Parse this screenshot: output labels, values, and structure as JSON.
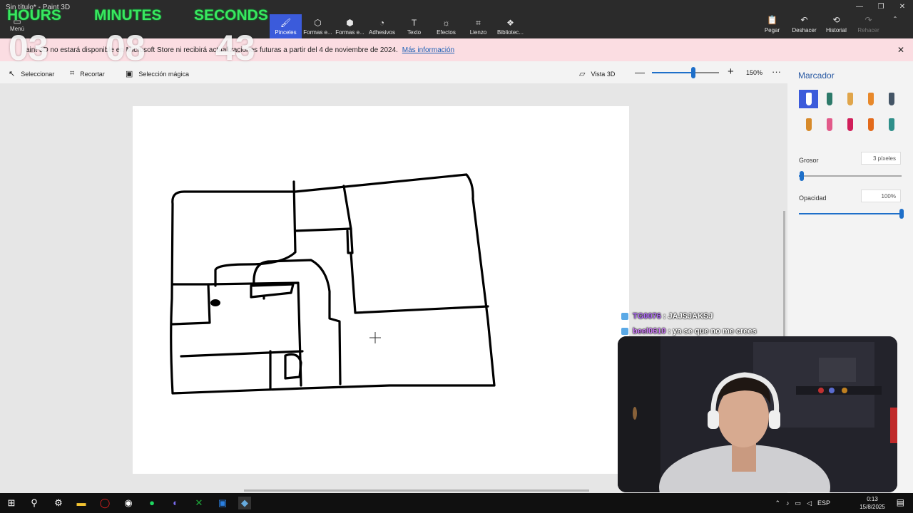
{
  "window": {
    "title": "Sin título* - Paint 3D",
    "controls": [
      "—",
      "❐",
      "✕"
    ]
  },
  "menu": {
    "label": "Menú",
    "icon": "folder-icon"
  },
  "ribbon": {
    "tools": [
      {
        "label": "Pinceles",
        "icon": "brush-icon",
        "glyph": "🖌"
      },
      {
        "label": "Formas e...",
        "icon": "2d-shapes-icon",
        "glyph": "⬡"
      },
      {
        "label": "Formas e...",
        "icon": "3d-shapes-icon",
        "glyph": "⬢"
      },
      {
        "label": "Adhesivos",
        "icon": "sticker-icon",
        "glyph": "◔"
      },
      {
        "label": "Texto",
        "icon": "text-icon",
        "glyph": "T"
      },
      {
        "label": "Efectos",
        "icon": "effects-icon",
        "glyph": "☼"
      },
      {
        "label": "Lienzo",
        "icon": "canvas-icon",
        "glyph": "⌗"
      },
      {
        "label": "Bibliotec...",
        "icon": "library-icon",
        "glyph": "❖"
      }
    ],
    "actions": [
      {
        "label": "Pegar",
        "glyph": "📋"
      },
      {
        "label": "Deshacer",
        "glyph": "↶"
      },
      {
        "label": "Historial",
        "glyph": "⟲"
      },
      {
        "label": "Rehacer",
        "glyph": "↷"
      }
    ],
    "collapse_glyph": "⌃"
  },
  "timer": {
    "labels": [
      "HOURS",
      "MINUTES",
      "SECONDS"
    ],
    "hours": "03",
    "minutes": "08",
    "seconds": "43"
  },
  "banner": {
    "text": "aint 3D no estará disponible en Microsoft Store ni recibirá actualizaciones futuras a partir del 4 de noviembre de 2024.",
    "link": "Más información",
    "close": "✕"
  },
  "subbar": {
    "select": "Seleccionar",
    "crop": "Recortar",
    "magic": "Selección mágica",
    "view3d": "Vista 3D",
    "zoom_percent": 0.62,
    "zoom_value": "150%",
    "more": "···",
    "minus": "—",
    "plus": "+"
  },
  "panel": {
    "title": "Marcador",
    "brushes": [
      {
        "name": "marker",
        "color": "#2a5aa3"
      },
      {
        "name": "calligraphy-pen",
        "color": "#2d7a6a"
      },
      {
        "name": "oil-brush",
        "color": "#e0a54a"
      },
      {
        "name": "watercolor",
        "color": "#e8882a"
      },
      {
        "name": "pixel-pen",
        "color": "#445566"
      },
      {
        "name": "pencil",
        "color": "#d78a2a"
      },
      {
        "name": "eraser",
        "color": "#e25a8a"
      },
      {
        "name": "crayon",
        "color": "#d11f5a"
      },
      {
        "name": "spray-can",
        "color": "#e36a1a"
      },
      {
        "name": "fill",
        "color": "#2f8f8a"
      }
    ],
    "thickness_label": "Grosor",
    "thickness_value": "3 píxeles",
    "thickness_level": 0.03,
    "opacity_label": "Opacidad",
    "opacity_value": "100%",
    "opacity_level": 1.0
  },
  "chat": [
    {
      "user": "TG0076",
      "message": "JAJSJAKSJ",
      "color": "#b46bff"
    },
    {
      "user": "beel0610",
      "message": "ya se que no me crees",
      "color": "#d27bff"
    }
  ],
  "taskbar": {
    "language": "ESP",
    "time": "0:13",
    "date": "15/8/2025"
  }
}
